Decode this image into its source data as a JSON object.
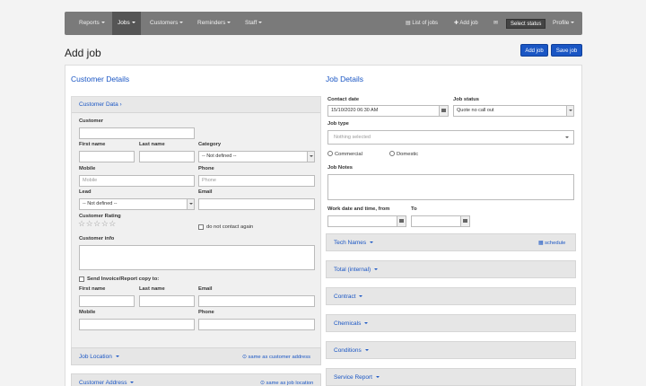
{
  "nav": {
    "items": [
      {
        "label": "Reports"
      },
      {
        "label": "Jobs"
      },
      {
        "label": "Customers"
      },
      {
        "label": "Reminders"
      },
      {
        "label": "Staff"
      }
    ],
    "list_jobs": "List of jobs",
    "add_job": "Add job",
    "select_status": "Select status",
    "profile": "Profile"
  },
  "page": {
    "title": "Add job",
    "add_job_btn": "Add job",
    "save_job_btn": "Save job"
  },
  "customer": {
    "section_title": "Customer Details",
    "data_header": "Customer Data",
    "customer_label": "Customer",
    "first_name": "First name",
    "last_name": "Last name",
    "category": "Category",
    "category_value": "-- Not defined --",
    "mobile": "Mobile",
    "mobile_placeholder": "Mobile",
    "phone": "Phone",
    "phone_placeholder": "Phone",
    "lead": "Lead",
    "lead_value": "-- Not defined --",
    "email": "Email",
    "rating": "Customer Rating",
    "rating_stars": "☆☆☆☆☆",
    "do_not_contact": "do not contact again",
    "info": "Customer info",
    "send_copy": "Send Invoice/Report copy to:",
    "copy_first": "First name",
    "copy_last": "Last name",
    "copy_email": "Email",
    "copy_mobile": "Mobile",
    "copy_phone": "Phone",
    "job_location": "Job Location",
    "same_as_customer": "same as customer address",
    "customer_address": "Customer Address",
    "same_as_job": "same as job location"
  },
  "job": {
    "section_title": "Job Details",
    "contact_date": "Contact date",
    "contact_date_value": "15/10/2020 06:30 AM",
    "job_status": "Job status",
    "job_status_value": "Quote no call out",
    "job_type": "Job type",
    "job_type_placeholder": "Nothing selected",
    "commercial": "Commercial",
    "domestic": "Domestic",
    "job_notes": "Job Notes",
    "work_from": "Work date and time, from",
    "work_to": "To",
    "tech_names": "Tech Names",
    "schedule": "schedule",
    "total": "Total (internal)",
    "contract": "Contract",
    "chemicals": "Chemicals",
    "conditions": "Conditions",
    "service_report": "Service Report"
  }
}
